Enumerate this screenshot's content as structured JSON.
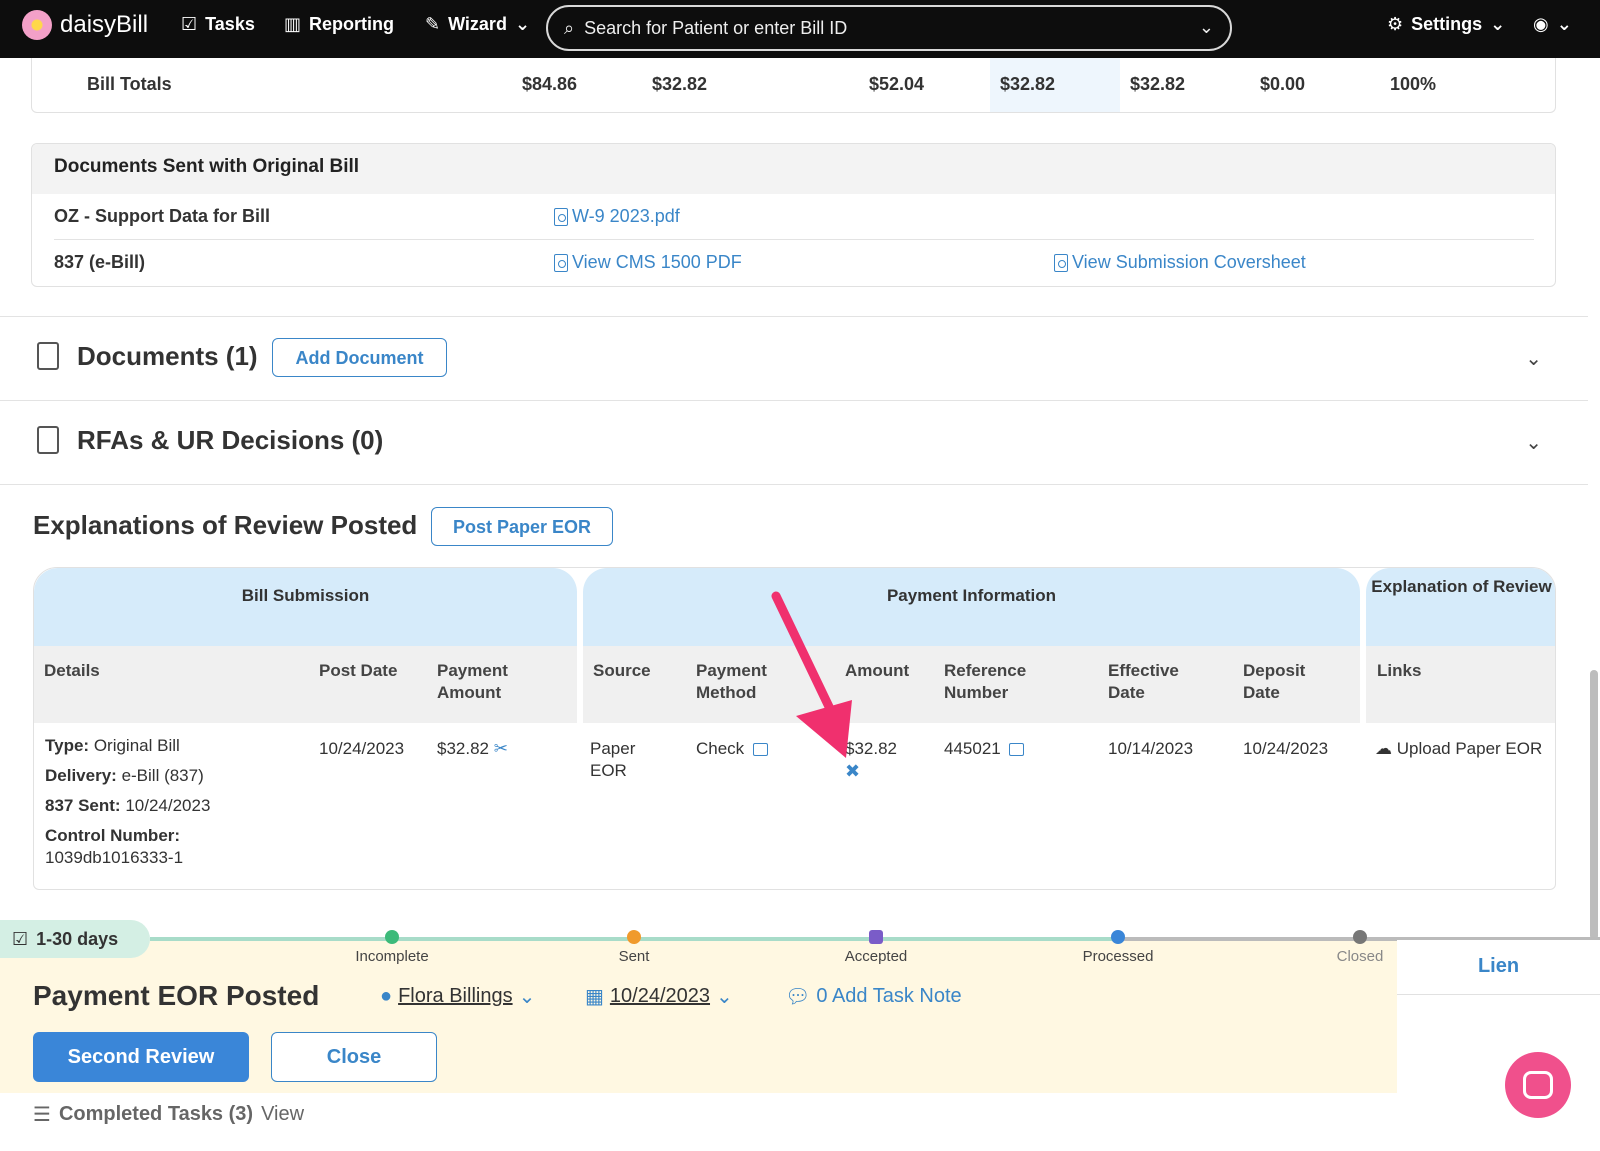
{
  "nav": {
    "brand": "daisyBill",
    "tasks": "Tasks",
    "reporting": "Reporting",
    "wizard": "Wizard",
    "search_placeholder": "Search for Patient or enter Bill ID",
    "settings": "Settings"
  },
  "bill_totals": {
    "label": "Bill Totals",
    "values": [
      "$84.86",
      "$32.82",
      "$52.04",
      "$32.82",
      "$32.82",
      "$0.00",
      "100%"
    ]
  },
  "docs_sent": {
    "title": "Documents Sent with Original Bill",
    "rows": [
      {
        "label": "OZ - Support Data for Bill",
        "link1": "W-9 2023.pdf",
        "link2": ""
      },
      {
        "label": "837 (e-Bill)",
        "link1": "View CMS 1500 PDF",
        "link2": "View Submission Coversheet"
      }
    ]
  },
  "documents": {
    "title": "Documents (1)",
    "button": "Add Document"
  },
  "rfas": {
    "title": "RFAs & UR Decisions (0)"
  },
  "eor": {
    "title": "Explanations of Review Posted",
    "button": "Post Paper EOR",
    "groups": {
      "bill_submission": "Bill Submission",
      "payment_information": "Payment Information",
      "explanation": "Explanation of Review"
    },
    "headers": {
      "details": "Details",
      "post_date": "Post Date",
      "payment_amount": "Payment Amount",
      "source": "Source",
      "payment_method": "Payment Method",
      "amount": "Amount",
      "reference_number": "Reference Number",
      "effective_date": "Effective Date",
      "deposit_date": "Deposit Date",
      "links": "Links"
    },
    "row": {
      "type_label": "Type:",
      "type_value": "Original Bill",
      "delivery_label": "Delivery:",
      "delivery_value": "e-Bill (837)",
      "sent_label": "837 Sent:",
      "sent_value": "10/24/2023",
      "control_label": "Control Number:",
      "control_value": "1039db1016333-1",
      "post_date": "10/24/2023",
      "payment_amount": "$32.82",
      "source": "Paper EOR",
      "payment_method": "Check",
      "amount": "$32.82",
      "reference_number": "445021",
      "effective_date": "10/14/2023",
      "deposit_date": "10/24/2023",
      "link": "Upload Paper EOR"
    }
  },
  "task": {
    "days": "1-30 days",
    "stages": [
      "Incomplete",
      "Sent",
      "Accepted",
      "Processed",
      "Closed"
    ],
    "title": "Payment EOR Posted",
    "assignee": "Flora Billings",
    "date": "10/24/2023",
    "note": "0 Add Task Note",
    "primary_button": "Second Review",
    "close_button": "Close",
    "lien": "Lien",
    "completed": "Completed Tasks (3)",
    "view": "View"
  },
  "colors": {
    "accent": "#3a86c8",
    "nav_bg": "#0d0d0d",
    "header_bg": "#d6ebfa",
    "task_bg": "#fff8e2",
    "arrow": "#f0306e"
  }
}
